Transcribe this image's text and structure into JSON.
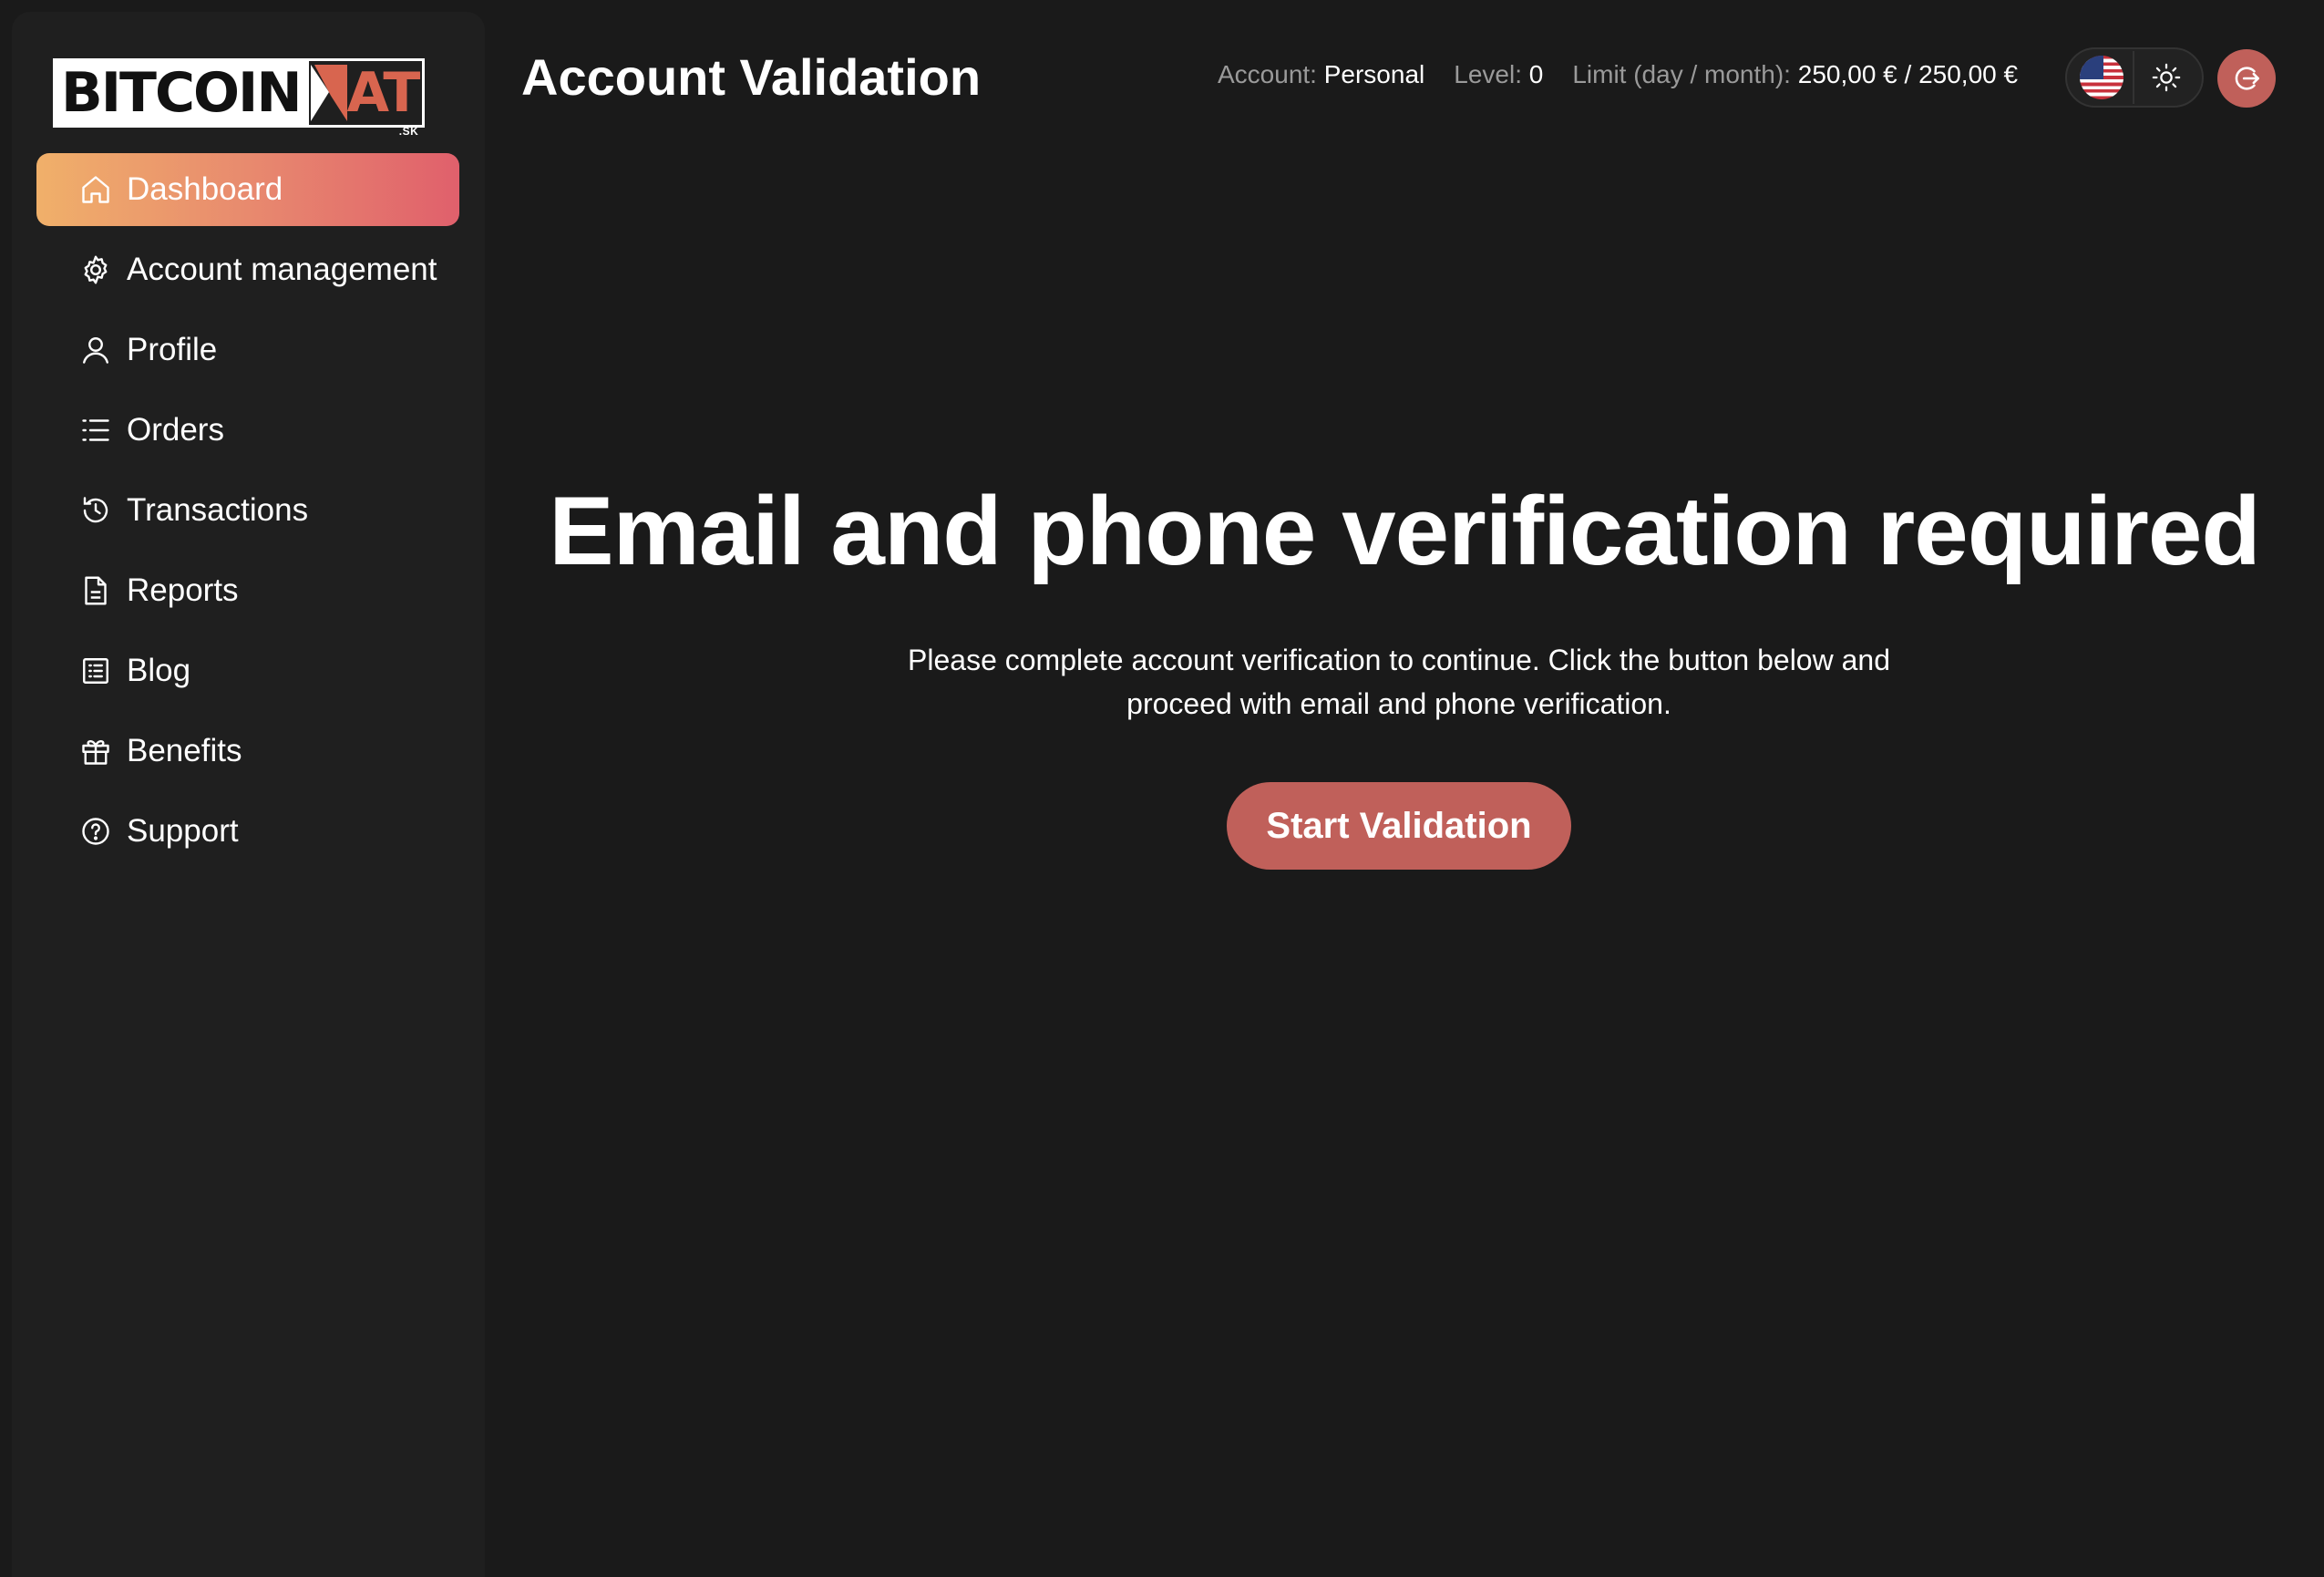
{
  "brand": {
    "logo_text_left": "BITCOIN",
    "logo_text_right": "AT",
    "logo_suffix": ".SK",
    "accent_color": "#c0605a"
  },
  "sidebar": {
    "items": [
      {
        "label": "Dashboard",
        "icon": "home-icon",
        "active": true
      },
      {
        "label": "Account management",
        "icon": "gear-icon",
        "active": false
      },
      {
        "label": "Profile",
        "icon": "user-icon",
        "active": false
      },
      {
        "label": "Orders",
        "icon": "list-icon",
        "active": false
      },
      {
        "label": "Transactions",
        "icon": "history-icon",
        "active": false
      },
      {
        "label": "Reports",
        "icon": "document-icon",
        "active": false
      },
      {
        "label": "Blog",
        "icon": "blog-icon",
        "active": false
      },
      {
        "label": "Benefits",
        "icon": "gift-icon",
        "active": false
      },
      {
        "label": "Support",
        "icon": "help-icon",
        "active": false
      }
    ]
  },
  "header": {
    "title": "Account Validation",
    "account_label": "Account:",
    "account_value": "Personal",
    "level_label": "Level:",
    "level_value": "0",
    "limit_label": "Limit (day / month):",
    "limit_value": "250,00 € / 250,00 €",
    "language_icon": "us-flag-icon",
    "theme_icon": "sun-icon",
    "logout_icon": "logout-icon"
  },
  "main": {
    "heading": "Email and phone verification required",
    "description": "Please complete account verification to continue. Click the button below and proceed with email and phone verification.",
    "cta_label": "Start Validation"
  }
}
